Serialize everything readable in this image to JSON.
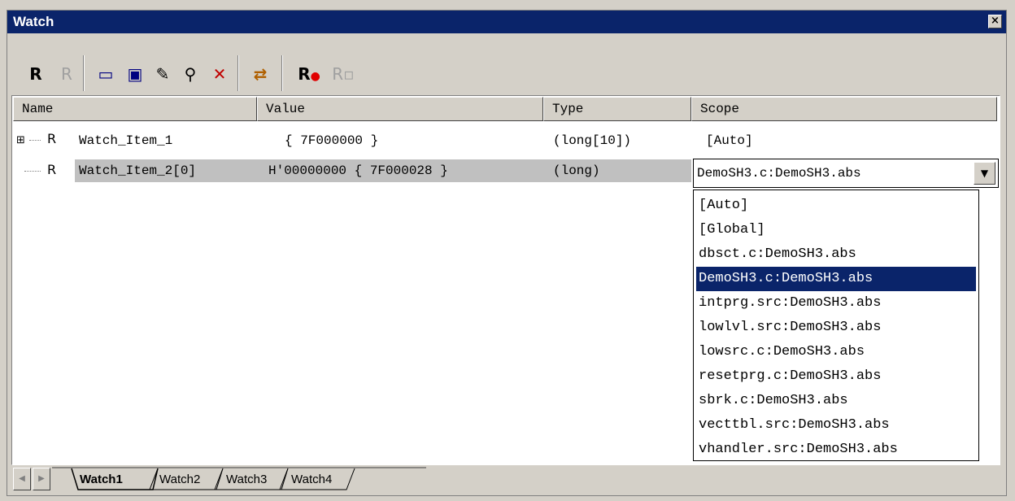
{
  "window": {
    "title": "Watch",
    "close_glyph": "×"
  },
  "toolbar": {
    "buttons": [
      {
        "icon": "refresh-r-icon",
        "glyph": "R"
      },
      {
        "icon": "refresh-r-disabled-icon",
        "glyph": "R"
      },
      {
        "icon": "add-watch-icon",
        "glyph": "▭"
      },
      {
        "icon": "edit-value-icon",
        "glyph": "▣"
      },
      {
        "icon": "pencil-icon",
        "glyph": "✎"
      },
      {
        "icon": "find-icon",
        "glyph": "⚲"
      },
      {
        "icon": "delete-icon",
        "glyph": "✕"
      },
      {
        "icon": "scope-icon",
        "glyph": "⇄"
      },
      {
        "icon": "breakpoint-icon",
        "glyph": "R●"
      },
      {
        "icon": "breakpoint-disabled-icon",
        "glyph": "R▫"
      }
    ]
  },
  "columns": [
    "Name",
    "Value",
    "Type",
    "Scope"
  ],
  "rows": [
    {
      "expander": "⊞",
      "icon": "R",
      "name": "Watch_Item_1",
      "value": "{ 7F000000 }",
      "type": "(long[10])",
      "scope": "[Auto]"
    },
    {
      "expander": "",
      "icon": "R",
      "name": "Watch_Item_2[0]",
      "value": "H'00000000 { 7F000028 }",
      "type": "(long)",
      "scope": "DemoSH3.c:DemoSH3.abs"
    }
  ],
  "scope_dropdown": {
    "selected": "DemoSH3.c:DemoSH3.abs",
    "options": [
      "[Auto]",
      "[Global]",
      "dbsct.c:DemoSH3.abs",
      "DemoSH3.c:DemoSH3.abs",
      "intprg.src:DemoSH3.abs",
      "lowlvl.src:DemoSH3.abs",
      "lowsrc.c:DemoSH3.abs",
      "resetprg.c:DemoSH3.abs",
      "sbrk.c:DemoSH3.abs",
      "vecttbl.src:DemoSH3.abs",
      "vhandler.src:DemoSH3.abs"
    ],
    "highlighted_index": 3
  },
  "tabs": [
    {
      "label": "Watch1",
      "active": true
    },
    {
      "label": "Watch2",
      "active": false
    },
    {
      "label": "Watch3",
      "active": false
    },
    {
      "label": "Watch4",
      "active": false
    }
  ],
  "colors": {
    "titlebar": "#0a246a",
    "selection": "#0a246a",
    "row_highlight": "#c0c0c0",
    "face": "#d4d0c8",
    "breakpoint_red": "#e00000"
  }
}
